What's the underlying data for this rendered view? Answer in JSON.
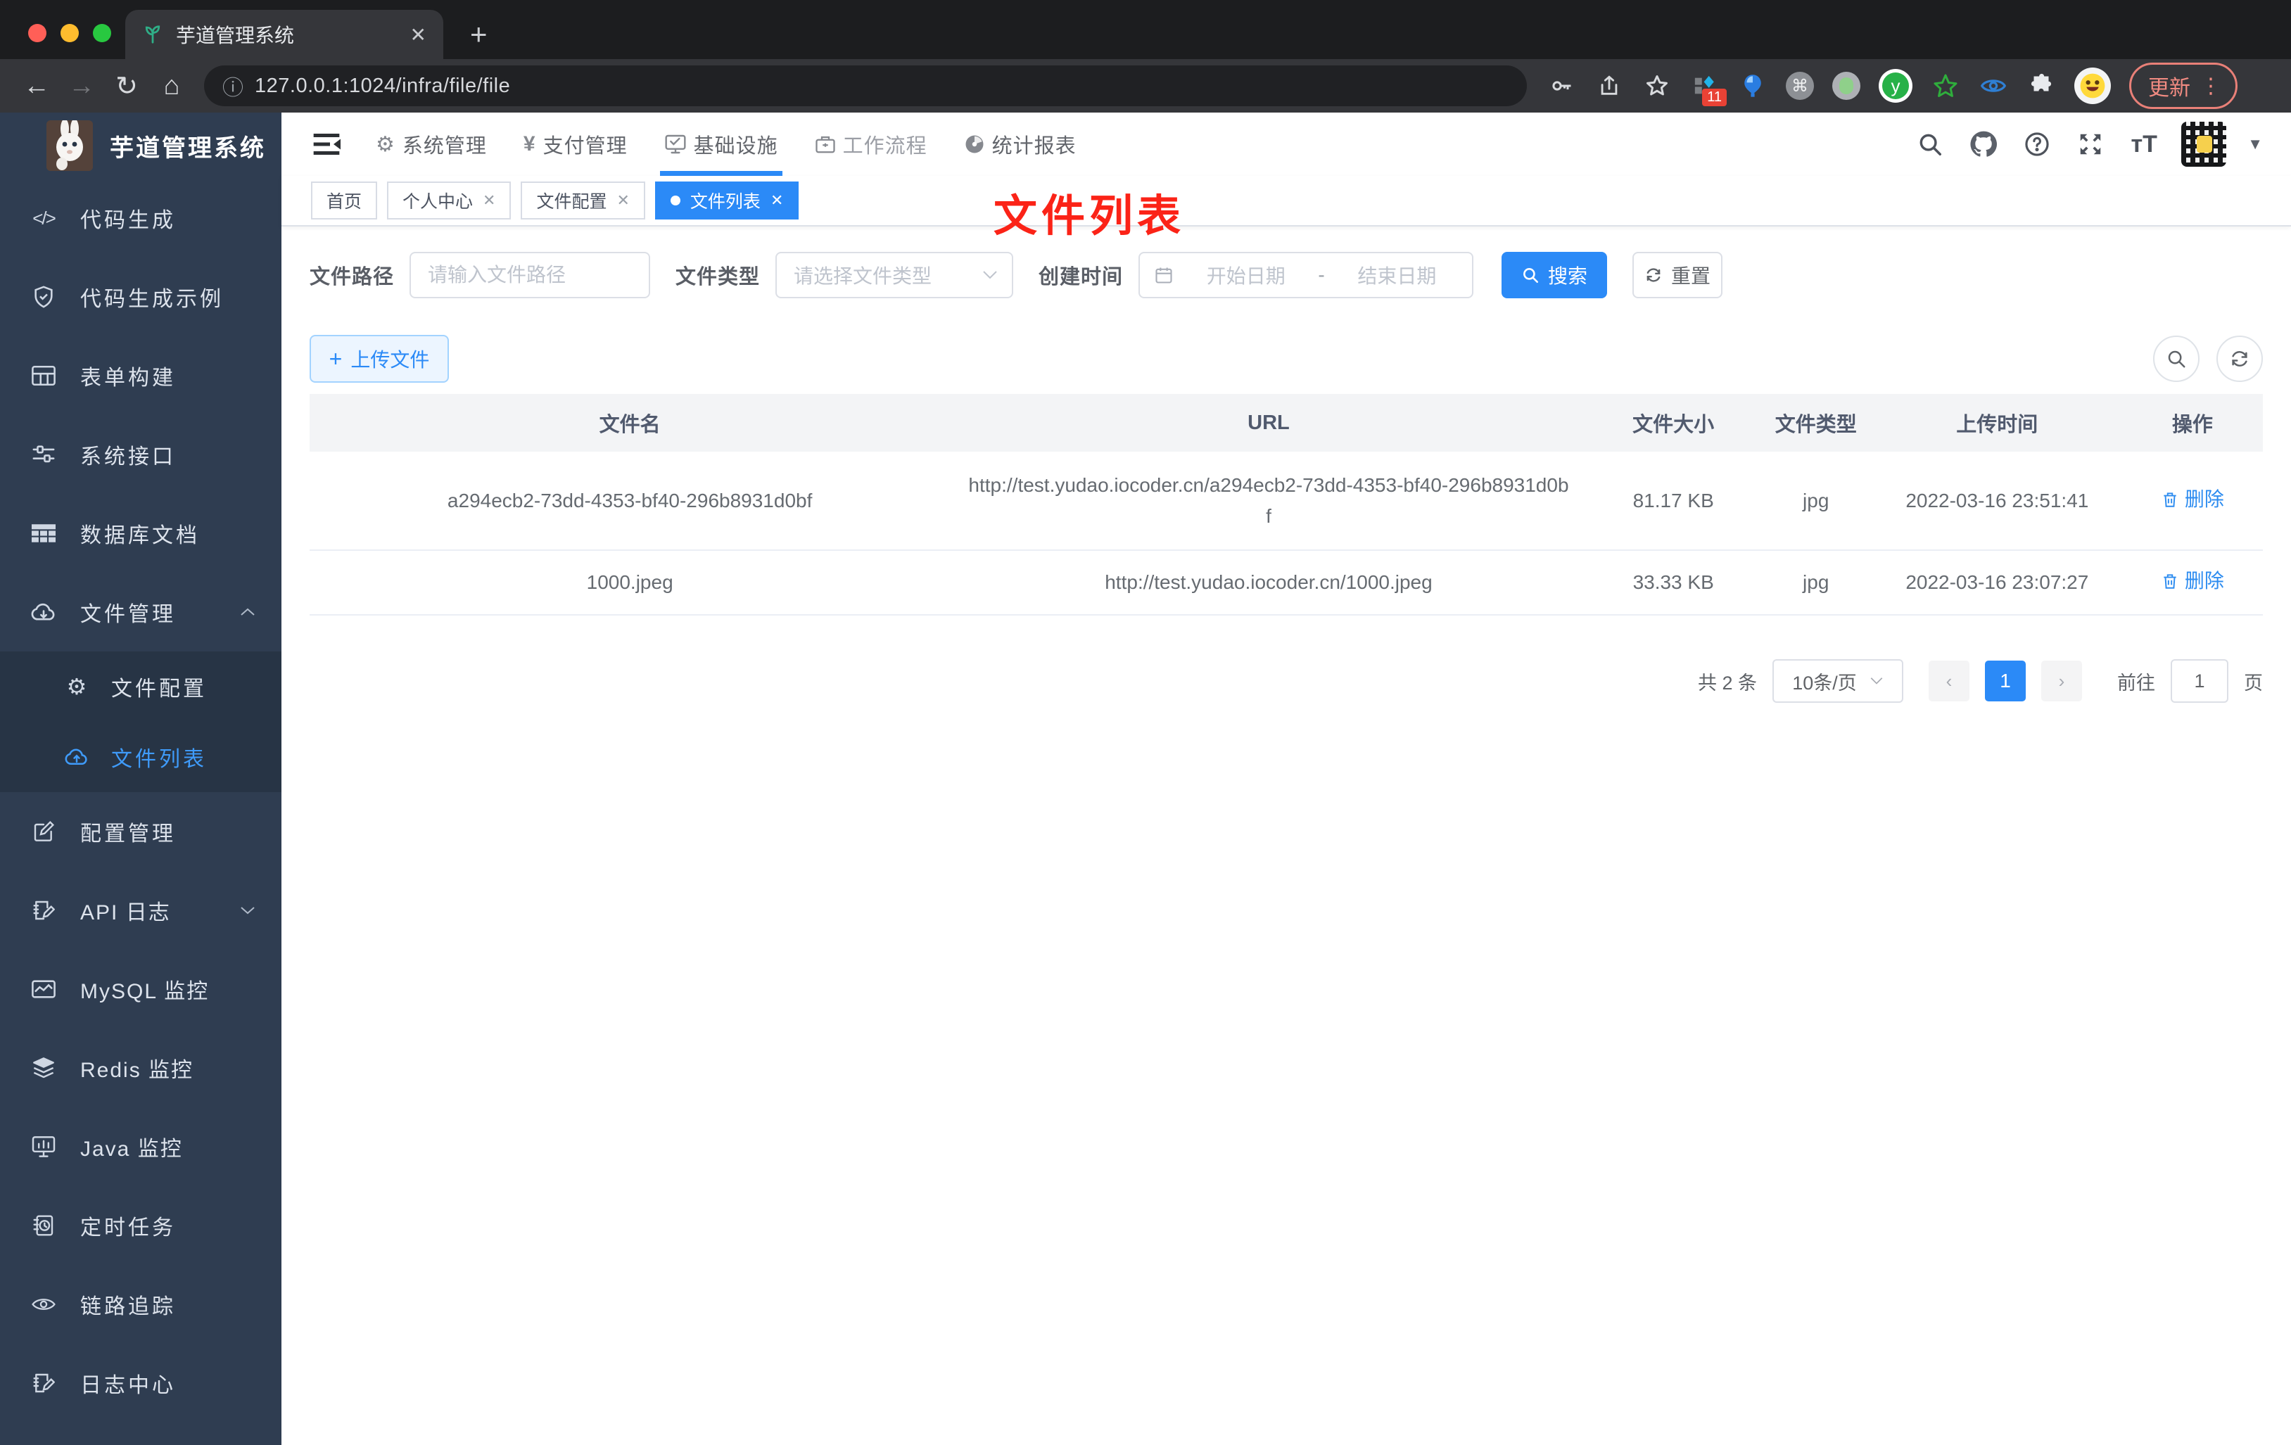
{
  "colors": {
    "accent": "#2b8af7",
    "sidebar_bg": "#2f3d51",
    "submenu_bg": "#273445",
    "annotation_red": "#fb2317"
  },
  "browser": {
    "tab_title": "芋道管理系统",
    "url": "127.0.0.1:1024/infra/file/file",
    "extension_badge": "11",
    "update_label": "更新"
  },
  "sidebar": {
    "title": "芋道管理系统",
    "items": [
      {
        "label": "代码生成"
      },
      {
        "label": "代码生成示例"
      },
      {
        "label": "表单构建"
      },
      {
        "label": "系统接口"
      },
      {
        "label": "数据库文档"
      },
      {
        "label": "文件管理"
      },
      {
        "label": "文件配置"
      },
      {
        "label": "文件列表"
      },
      {
        "label": "配置管理"
      },
      {
        "label": "API 日志"
      },
      {
        "label": "MySQL 监控"
      },
      {
        "label": "Redis 监控"
      },
      {
        "label": "Java 监控"
      },
      {
        "label": "定时任务"
      },
      {
        "label": "链路追踪"
      },
      {
        "label": "日志中心"
      }
    ]
  },
  "top_nav": {
    "items": [
      {
        "label": "系统管理"
      },
      {
        "label": "支付管理"
      },
      {
        "label": "基础设施"
      },
      {
        "label": "工作流程"
      },
      {
        "label": "统计报表"
      }
    ]
  },
  "view_tabs": {
    "tabs": [
      {
        "label": "首页"
      },
      {
        "label": "个人中心"
      },
      {
        "label": "文件配置"
      },
      {
        "label": "文件列表"
      }
    ]
  },
  "annotation": {
    "text": "文件列表"
  },
  "filters": {
    "path_label": "文件路径",
    "path_placeholder": "请输入文件路径",
    "type_label": "文件类型",
    "type_placeholder": "请选择文件类型",
    "date_label": "创建时间",
    "date_start_placeholder": "开始日期",
    "date_separator": "-",
    "date_end_placeholder": "结束日期",
    "search_label": "搜索",
    "reset_label": "重置"
  },
  "toolbar": {
    "upload_label": "上传文件"
  },
  "table": {
    "columns": [
      "文件名",
      "URL",
      "文件大小",
      "文件类型",
      "上传时间",
      "操作"
    ],
    "rows": [
      {
        "name": "a294ecb2-73dd-4353-bf40-296b8931d0bf",
        "url": "http://test.yudao.iocoder.cn/a294ecb2-73dd-4353-bf40-296b8931d0bf",
        "size": "81.17 KB",
        "type": "jpg",
        "time": "2022-03-16 23:51:41",
        "action": "删除"
      },
      {
        "name": "1000.jpeg",
        "url": "http://test.yudao.iocoder.cn/1000.jpeg",
        "size": "33.33 KB",
        "type": "jpg",
        "time": "2022-03-16 23:07:27",
        "action": "删除"
      }
    ]
  },
  "pagination": {
    "total": "共 2 条",
    "page_size": "10条/页",
    "current_page": "1",
    "goto_label": "前往",
    "page_unit": "页"
  }
}
